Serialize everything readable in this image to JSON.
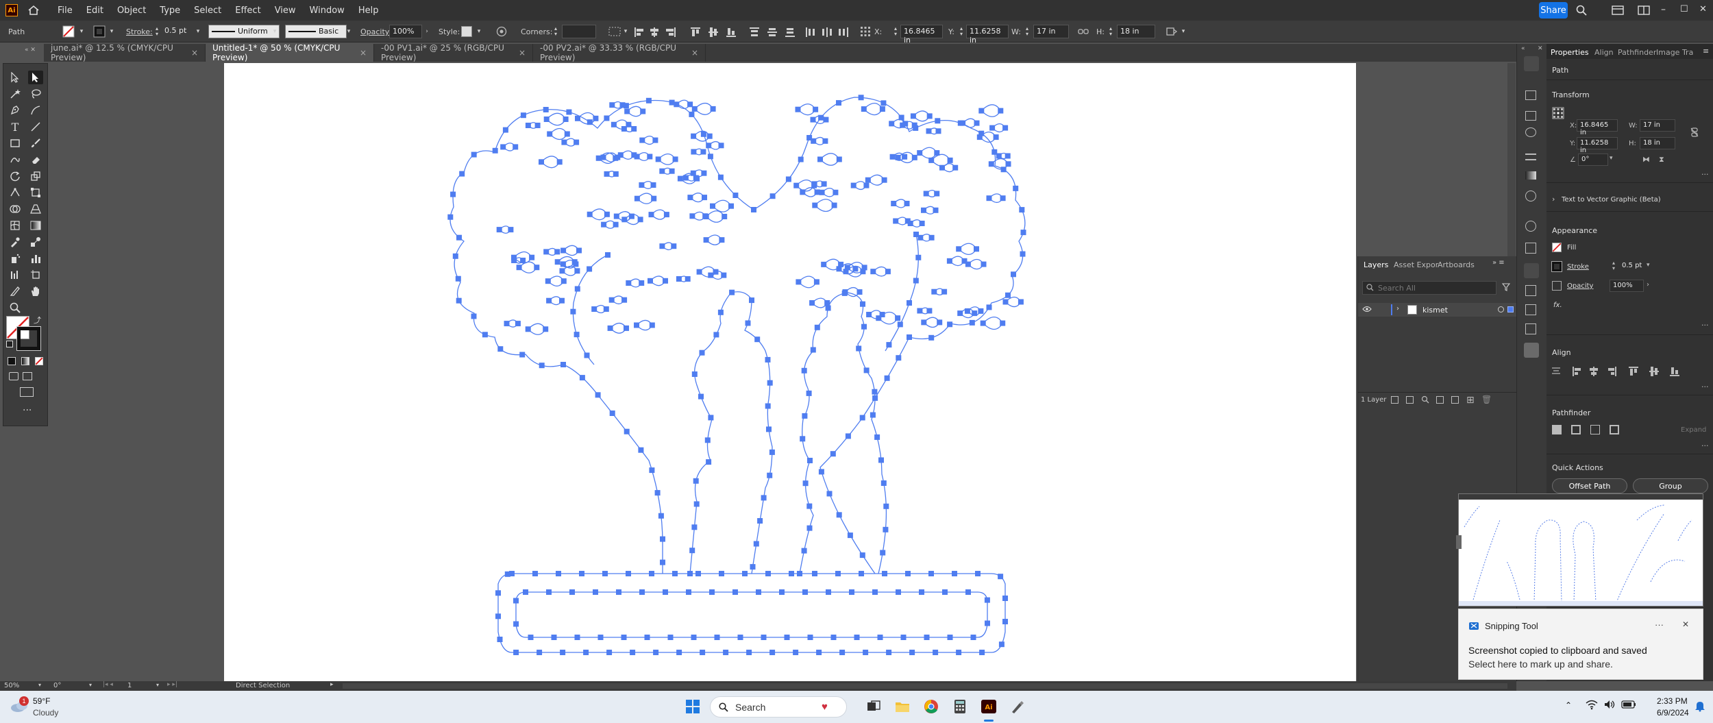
{
  "menubar": {
    "app_logo": "Ai",
    "items": [
      "File",
      "Edit",
      "Object",
      "Type",
      "Select",
      "Effect",
      "View",
      "Window",
      "Help"
    ],
    "share_label": "Share"
  },
  "controlbar": {
    "selection_type": "Path",
    "stroke_label": "Stroke:",
    "stroke_value": "0.5 pt",
    "profile_value": "Uniform",
    "brush_value": "Basic",
    "opacity_label": "Opacity:",
    "opacity_value": "100%",
    "style_label": "Style:",
    "corners_label": "Corners:",
    "x_label": "X:",
    "x_value": "16.8465 in",
    "y_label": "Y:",
    "y_value": "11.6258 in",
    "w_label": "W:",
    "w_value": "17 in",
    "h_label": "H:",
    "h_value": "18 in"
  },
  "tabs": [
    {
      "label": "june.ai* @ 12.5 % (CMYK/CPU Preview)",
      "active": false
    },
    {
      "label": "Untitled-1* @ 50 % (CMYK/CPU Preview)",
      "active": true
    },
    {
      "label": "-00 PV1.ai* @ 25 % (RGB/CPU Preview)",
      "active": false
    },
    {
      "label": "-00 PV2.ai* @ 33.33 % (RGB/CPU Preview)",
      "active": false
    }
  ],
  "tab_close_glyph": "×",
  "layers_panel": {
    "tabs": [
      "Layers",
      "Asset Expor",
      "Artboards"
    ],
    "search_placeholder": "Search All",
    "layer_name": "kismet",
    "footer_count": "1 Layer"
  },
  "properties_panel": {
    "tabs": [
      "Properties",
      "Align",
      "Pathfinder",
      "Image Tra"
    ],
    "object_type": "Path",
    "transform_title": "Transform",
    "x_label": "X:",
    "x_value": "16.8465 in",
    "y_label": "Y:",
    "y_value": "11.6258 in",
    "w_label": "W:",
    "w_value": "17 in",
    "h_label": "H:",
    "h_value": "18 in",
    "angle_value": "0°",
    "text_to_vector_label": "Text to Vector Graphic (Beta)",
    "appearance_title": "Appearance",
    "fill_label": "Fill",
    "stroke_label": "Stroke",
    "stroke_value": "0.5 pt",
    "opacity_label": "Opacity",
    "opacity_value": "100%",
    "fx_label": "fx.",
    "align_title": "Align",
    "pathfinder_title": "Pathfinder",
    "expand_label": "Expand",
    "quick_actions_title": "Quick Actions",
    "offset_path_label": "Offset Path",
    "group_label": "Group"
  },
  "statusbar": {
    "zoom_value": "50%",
    "rotate_value": "0°",
    "artboard_value": "1",
    "tool_label": "Direct Selection"
  },
  "toast": {
    "app_name": "Snipping Tool",
    "more_glyph": "···",
    "close_glyph": "✕",
    "title": "Screenshot copied to clipboard and saved",
    "subtitle": "Select here to mark up and share."
  },
  "taskbar": {
    "weather_temp": "59°F",
    "weather_desc": "Cloudy",
    "search_label": "Search",
    "notification_badge": "1",
    "time": "2:33 PM",
    "date": "6/9/2024"
  },
  "colors": {
    "selection_blue": "#4f7df0",
    "share_blue": "#1473e6",
    "ai_orange": "#ff9a00"
  }
}
